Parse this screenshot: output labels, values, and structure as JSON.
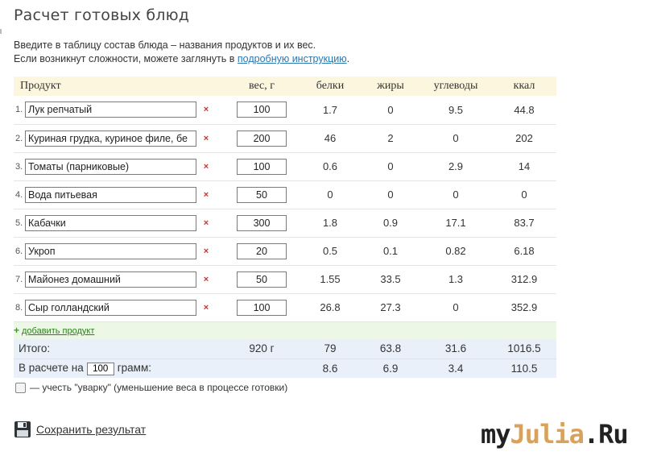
{
  "page": {
    "title": "Расчет готовых блюд",
    "intro_line1": "Введите в таблицу состав блюда – названия продуктов и их вес.",
    "intro_line2_prefix": "Если возникнут сложности, можете заглянуть в ",
    "intro_link": "подробную инструкцию",
    "intro_line2_suffix": "."
  },
  "table": {
    "headers": {
      "product": "Продукт",
      "weight": "вес, г",
      "protein": "белки",
      "fat": "жиры",
      "carbs": "углеводы",
      "kcal": "ккал"
    },
    "rows": [
      {
        "n": "1.",
        "name": "Лук репчатый",
        "weight": "100",
        "protein": "1.7",
        "fat": "0",
        "carbs": "9.5",
        "kcal": "44.8"
      },
      {
        "n": "2.",
        "name": "Куриная грудка, куриное филе, бе",
        "weight": "200",
        "protein": "46",
        "fat": "2",
        "carbs": "0",
        "kcal": "202"
      },
      {
        "n": "3.",
        "name": "Томаты (парниковые)",
        "weight": "100",
        "protein": "0.6",
        "fat": "0",
        "carbs": "2.9",
        "kcal": "14"
      },
      {
        "n": "4.",
        "name": "Вода питьевая",
        "weight": "50",
        "protein": "0",
        "fat": "0",
        "carbs": "0",
        "kcal": "0"
      },
      {
        "n": "5.",
        "name": "Кабачки",
        "weight": "300",
        "protein": "1.8",
        "fat": "0.9",
        "carbs": "17.1",
        "kcal": "83.7"
      },
      {
        "n": "6.",
        "name": "Укроп",
        "weight": "20",
        "protein": "0.5",
        "fat": "0.1",
        "carbs": "0.82",
        "kcal": "6.18"
      },
      {
        "n": "7.",
        "name": "Майонез домашний",
        "weight": "50",
        "protein": "1.55",
        "fat": "33.5",
        "carbs": "1.3",
        "kcal": "312.9"
      },
      {
        "n": "8.",
        "name": "Сыр голландский",
        "weight": "100",
        "protein": "26.8",
        "fat": "27.3",
        "carbs": "0",
        "kcal": "352.9"
      }
    ],
    "delete_icon": "×",
    "add_product": "добавить продукт",
    "add_icon": "+",
    "total": {
      "label": "Итого:",
      "weight": "920 г",
      "protein": "79",
      "fat": "63.8",
      "carbs": "31.6",
      "kcal": "1016.5"
    },
    "per": {
      "label_prefix": "В расчете на",
      "amount": "100",
      "label_suffix": "грамм:",
      "protein": "8.6",
      "fat": "6.9",
      "carbs": "3.4",
      "kcal": "110.5"
    }
  },
  "options": {
    "boil_checkbox_label": "— учесть \"уварку\" (уменьшение веса в процессе готовки)",
    "boil_checked": false
  },
  "actions": {
    "save_label": "Сохранить результат",
    "save_icon": "floppy-disk-icon"
  },
  "logo": {
    "part1": "my",
    "part2": "Julia",
    "part3": ".Ru"
  },
  "colors": {
    "header_bg": "#fcf6de",
    "add_row_bg": "#edf7e6",
    "total_bg": "#e9f0fa",
    "delete_red": "#c83333",
    "link_blue": "#2a78b0",
    "logo_gold": "#d9a25c"
  }
}
